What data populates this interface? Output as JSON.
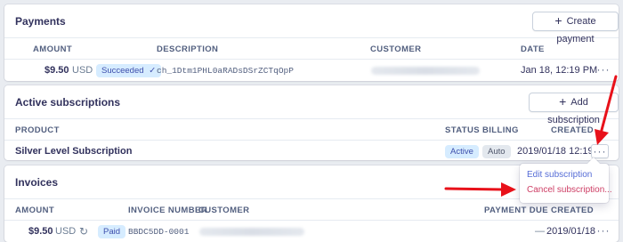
{
  "colors": {
    "accent": "#556cd6",
    "danger": "#cd3d64",
    "annotation_arrow": "#e8111a",
    "succeeded_badge": "#d6ecff",
    "neutral_badge": "#e3e8ee"
  },
  "payments": {
    "title": "Payments",
    "create_button": "Create payment",
    "columns": {
      "amount": "AMOUNT",
      "description": "DESCRIPTION",
      "customer": "CUSTOMER",
      "date": "DATE"
    },
    "rows": [
      {
        "amount": "$9.50",
        "currency": "USD",
        "status": "Succeeded",
        "status_icon": "checkmark-icon",
        "description": "ch_1Dtm1PHL0aRADsDSrZCTqOpP",
        "date": "Jan 18, 12:19 PM"
      }
    ]
  },
  "subscriptions": {
    "title": "Active subscriptions",
    "add_button": "Add subscription",
    "columns": {
      "product": "PRODUCT",
      "status": "STATUS",
      "billing": "BILLING",
      "created": "CREATED"
    },
    "rows": [
      {
        "product": "Silver Level Subscription",
        "status": "Active",
        "billing": "Auto",
        "created": "2019/01/18 12:19"
      }
    ],
    "menu": {
      "edit": "Edit subscription",
      "cancel": "Cancel subscription..."
    }
  },
  "invoices": {
    "title": "Invoices",
    "columns": {
      "amount": "AMOUNT",
      "invoice_number": "INVOICE NUMBER",
      "customer": "CUSTOMER",
      "payment_due": "PAYMENT DUE",
      "created": "CREATED"
    },
    "rows": [
      {
        "amount": "$9.50",
        "currency": "USD",
        "recurring_icon": "refresh-icon",
        "status": "Paid",
        "invoice_number": "BBDC5DD-0001",
        "payment_due": "—",
        "created": "2019/01/18"
      }
    ]
  },
  "icons": {
    "add": "plus-icon",
    "more": "more-options-icon",
    "annotation": "red-arrow-icon"
  }
}
